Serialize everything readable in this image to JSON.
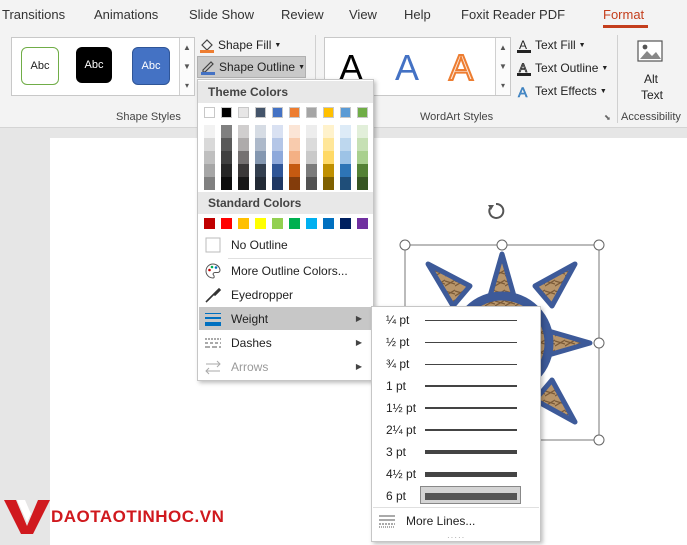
{
  "tabs": [
    "Transitions",
    "Animations",
    "Slide Show",
    "Review",
    "View",
    "Help",
    "Foxit Reader PDF",
    "Format"
  ],
  "active_tab": "Format",
  "shape_styles": {
    "presets": [
      "Abc",
      "Abc",
      "Abc"
    ],
    "shape_fill": "Shape Fill",
    "shape_outline": "Shape Outline",
    "group_label": "Shape Styles"
  },
  "wordart": {
    "letters": [
      "A",
      "A",
      "A"
    ],
    "text_fill": "Text Fill",
    "text_outline": "Text Outline",
    "text_effects": "Text Effects",
    "group_label": "WordArt Styles"
  },
  "accessibility": {
    "alt_text_line1": "Alt",
    "alt_text_line2": "Text",
    "group_label": "Accessibility"
  },
  "outline_menu": {
    "theme_colors_header": "Theme Colors",
    "standard_colors_header": "Standard Colors",
    "theme_top_row": [
      "#ffffff",
      "#000000",
      "#e7e6e6",
      "#44546a",
      "#4472c4",
      "#ed7d31",
      "#a5a5a5",
      "#ffc000",
      "#5b9bd5",
      "#70ad47"
    ],
    "theme_shade_columns": [
      [
        "#f2f2f2",
        "#d9d9d9",
        "#bfbfbf",
        "#a6a6a6",
        "#808080"
      ],
      [
        "#808080",
        "#595959",
        "#404040",
        "#262626",
        "#0d0d0d"
      ],
      [
        "#d0cece",
        "#aeabab",
        "#757171",
        "#3b3838",
        "#171616"
      ],
      [
        "#d6dce4",
        "#adb9ca",
        "#8497b0",
        "#333f4f",
        "#222a35"
      ],
      [
        "#d9e1f2",
        "#b4c6e7",
        "#8ea9db",
        "#2f5597",
        "#1f3864"
      ],
      [
        "#fbe5d6",
        "#f8cbad",
        "#f4b084",
        "#c55a11",
        "#833c0b"
      ],
      [
        "#ededed",
        "#dbdbdb",
        "#c9c9c9",
        "#7b7b7b",
        "#525252"
      ],
      [
        "#fff2cc",
        "#ffe699",
        "#ffd966",
        "#bf8f00",
        "#7f6000"
      ],
      [
        "#ddebf7",
        "#bdd7ee",
        "#9dc3e6",
        "#2e75b6",
        "#1f4e79"
      ],
      [
        "#e2efda",
        "#c6e0b4",
        "#a9d08e",
        "#548235",
        "#375623"
      ]
    ],
    "standard_colors": [
      "#c00000",
      "#ff0000",
      "#ffc000",
      "#ffff00",
      "#92d050",
      "#00b050",
      "#00b0f0",
      "#0070c0",
      "#002060",
      "#7030a0"
    ],
    "no_outline": "No Outline",
    "more_colors": "More Outline Colors...",
    "eyedropper": "Eyedropper",
    "weight": "Weight",
    "dashes": "Dashes",
    "arrows": "Arrows"
  },
  "weight_menu": {
    "options": [
      "¼ pt",
      "½ pt",
      "¾ pt",
      "1 pt",
      "1½ pt",
      "2¼ pt",
      "3 pt",
      "4½ pt",
      "6 pt"
    ],
    "selected": "6 pt",
    "more_lines": "More Lines..."
  },
  "logo_text": "DAOTAOTINHOC.VN",
  "colors": {
    "accent": "#c43e1c",
    "shape_fill": "#3d5a99",
    "logo_red": "#d0191e"
  }
}
